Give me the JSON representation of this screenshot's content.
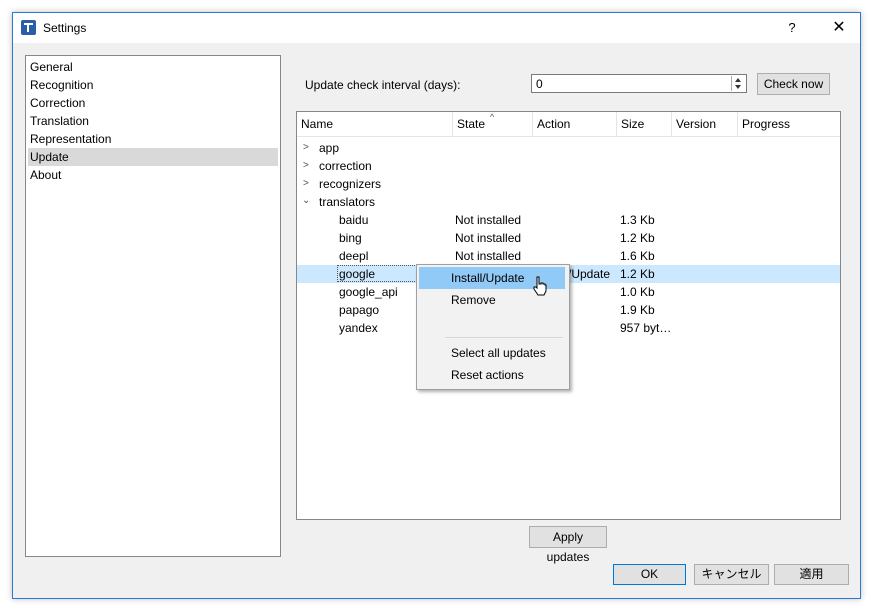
{
  "window": {
    "title": "Settings",
    "help_label": "?",
    "close_label": "✕"
  },
  "sidebar": {
    "items": [
      "General",
      "Recognition",
      "Correction",
      "Translation",
      "Representation",
      "Update",
      "About"
    ],
    "selected": "Update"
  },
  "update": {
    "interval_label": "Update check interval (days):",
    "interval_value": "0",
    "check_now_label": "Check now",
    "apply_updates_label": "Apply updates"
  },
  "tree": {
    "columns": [
      "Name",
      "State",
      "Action",
      "Size",
      "Version",
      "Progress"
    ],
    "groups": [
      {
        "name": "app",
        "expanded": false
      },
      {
        "name": "correction",
        "expanded": false
      },
      {
        "name": "recognizers",
        "expanded": false
      },
      {
        "name": "translators",
        "expanded": true
      }
    ],
    "items": [
      {
        "name": "baidu",
        "state": "Not installed",
        "action": "",
        "size": "1.3 Kb"
      },
      {
        "name": "bing",
        "state": "Not installed",
        "action": "",
        "size": "1.2 Kb"
      },
      {
        "name": "deepl",
        "state": "Not installed",
        "action": "",
        "size": "1.6 Kb"
      },
      {
        "name": "google",
        "state": "",
        "action": "/Update",
        "size": "1.2 Kb"
      },
      {
        "name": "google_api",
        "state": "",
        "action": "",
        "size": "1.0 Kb"
      },
      {
        "name": "papago",
        "state": "",
        "action": "",
        "size": "1.9 Kb"
      },
      {
        "name": "yandex",
        "state": "",
        "action": "",
        "size": "957 byt…"
      }
    ]
  },
  "context_menu": {
    "install_update": "Install/Update",
    "remove": "Remove",
    "select_all": "Select all updates",
    "reset_actions": "Reset actions"
  },
  "dialog_buttons": {
    "ok": "OK",
    "cancel": "キャンセル",
    "apply": "適用"
  },
  "colors": {
    "selection": "#cce8ff",
    "menu_hover": "#91c9f7",
    "accent": "#0078d7"
  }
}
